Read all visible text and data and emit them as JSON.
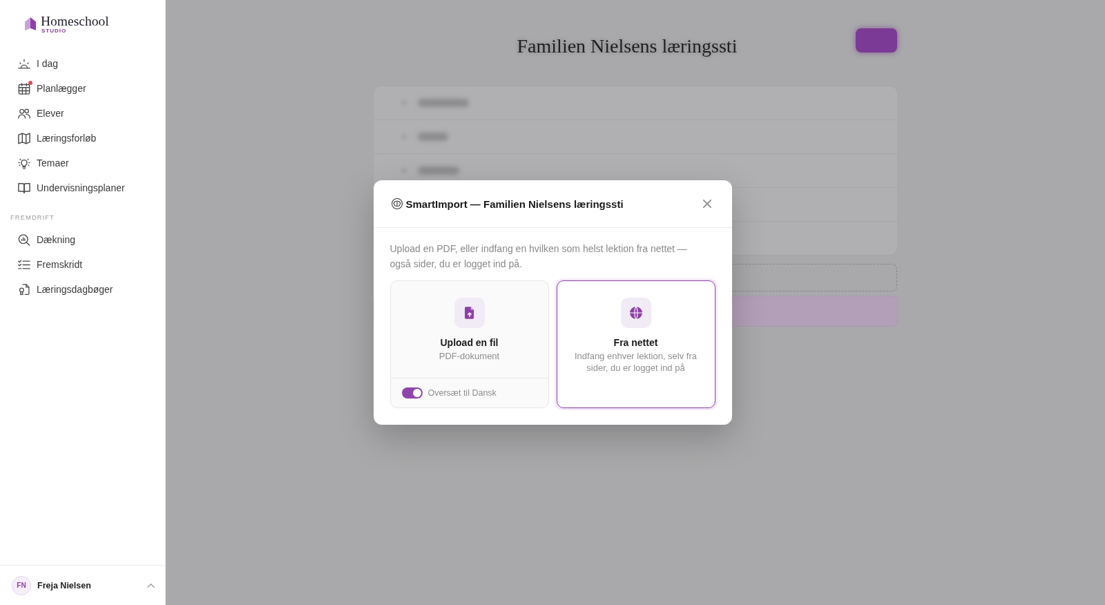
{
  "sidebar": {
    "logo": {
      "name": "Homeschool",
      "tagline": "STUDIO"
    },
    "sections": [
      {
        "items": [
          {
            "label": "I dag",
            "selected": false,
            "alert": false
          },
          {
            "label": "Planlægger",
            "selected": false,
            "alert": true
          },
          {
            "label": "Elever",
            "selected": false,
            "alert": false
          },
          {
            "label": "Læringsforløb",
            "selected": false,
            "alert": false
          },
          {
            "label": "Temaer",
            "selected": false,
            "alert": false
          },
          {
            "label": "Undervisningsplaner",
            "selected": false,
            "alert": false
          }
        ]
      },
      {
        "heading": "FREMDRIFT",
        "items": [
          {
            "label": "Dækning",
            "selected": false,
            "alert": false
          },
          {
            "label": "Fremskridt",
            "selected": false,
            "alert": false
          },
          {
            "label": "Læringsdagbøger",
            "selected": false,
            "alert": false
          }
        ]
      }
    ],
    "user": {
      "initials": "FN",
      "name": "Freja Nielsen"
    }
  },
  "page": {
    "title": "Familien Nielsens læringssti"
  },
  "modal": {
    "title": "SmartImport — Familien Nielsens læringssti",
    "description": "Upload en PDF, eller indfang en hvilken som helst lektion fra nettet — også sider, du er logget ind på.",
    "options": [
      {
        "kind": "file",
        "title": "Upload en fil",
        "subtitle": "PDF-dokument",
        "selected": false,
        "toggle": {
          "label": "Oversæt til Dansk",
          "on": true
        }
      },
      {
        "kind": "web",
        "title": "Fra nettet",
        "subtitle": "Indfang enhver lektion, selv fra sider, du er logget ind på",
        "selected": true
      }
    ]
  }
}
